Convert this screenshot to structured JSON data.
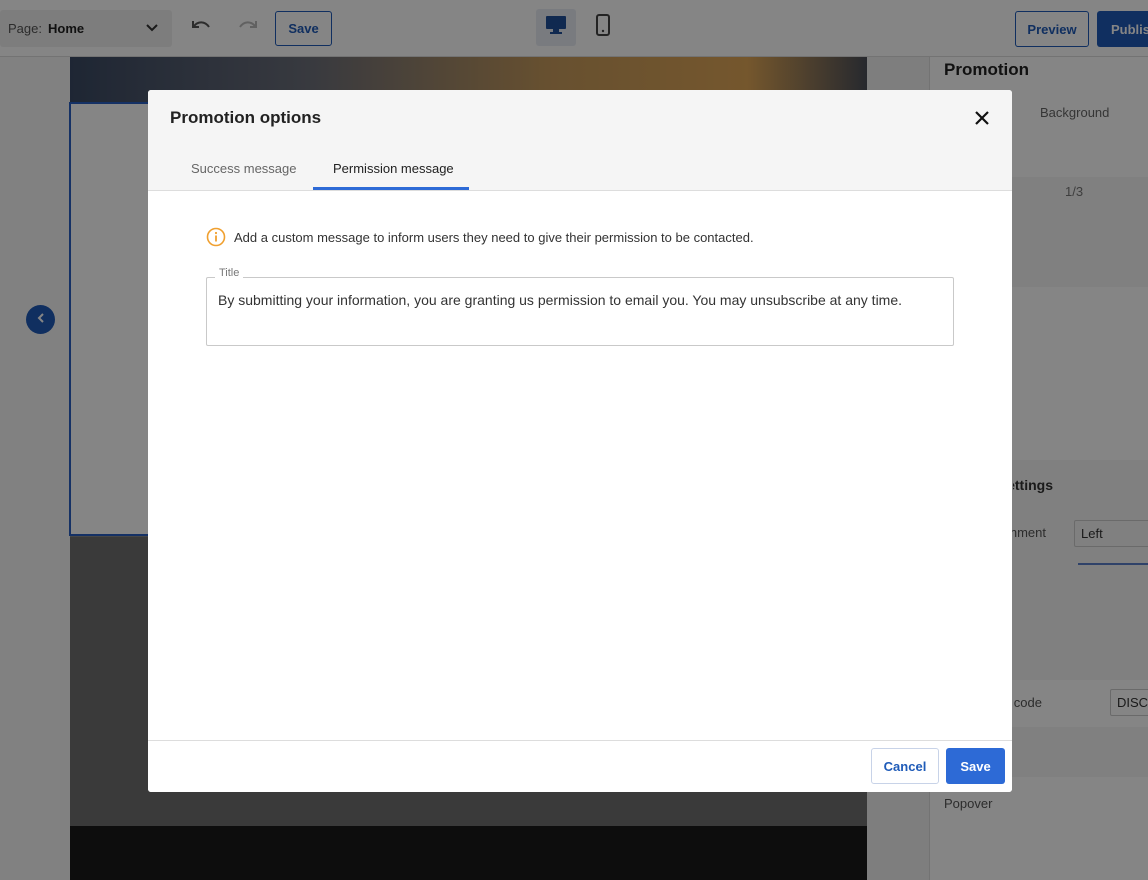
{
  "toolbar": {
    "page_label": "Page:",
    "page_value": "Home",
    "save_label": "Save",
    "preview_label": "Preview",
    "publish_label": "Publish"
  },
  "right_panel": {
    "title": "Promotion",
    "tab_background": "Background",
    "count": "1/3",
    "settings_heading": "Settings",
    "alignment_label": "Alignment",
    "alignment_value": "Left",
    "code_label": "Discount code",
    "code_value": "DISCOUNT",
    "display_value": "Popover"
  },
  "modal": {
    "title": "Promotion options",
    "tabs": [
      {
        "label": "Success message",
        "active": false
      },
      {
        "label": "Permission message",
        "active": true
      }
    ],
    "info_text": "Add a custom message to inform users they need to give their permission to be contacted.",
    "field": {
      "legend": "Title",
      "value": "By submitting your information, you are granting us permission to email you. You may unsubscribe at any time."
    },
    "cancel_label": "Cancel",
    "save_label": "Save"
  },
  "colors": {
    "accent": "#2d6ad6",
    "brand_blue": "#1f5bb8",
    "info_orange": "#f0a030"
  },
  "icons": [
    "chevron-down-icon",
    "undo-icon",
    "redo-icon",
    "desktop-icon",
    "mobile-icon",
    "chevron-left-icon",
    "close-icon",
    "info-icon"
  ]
}
